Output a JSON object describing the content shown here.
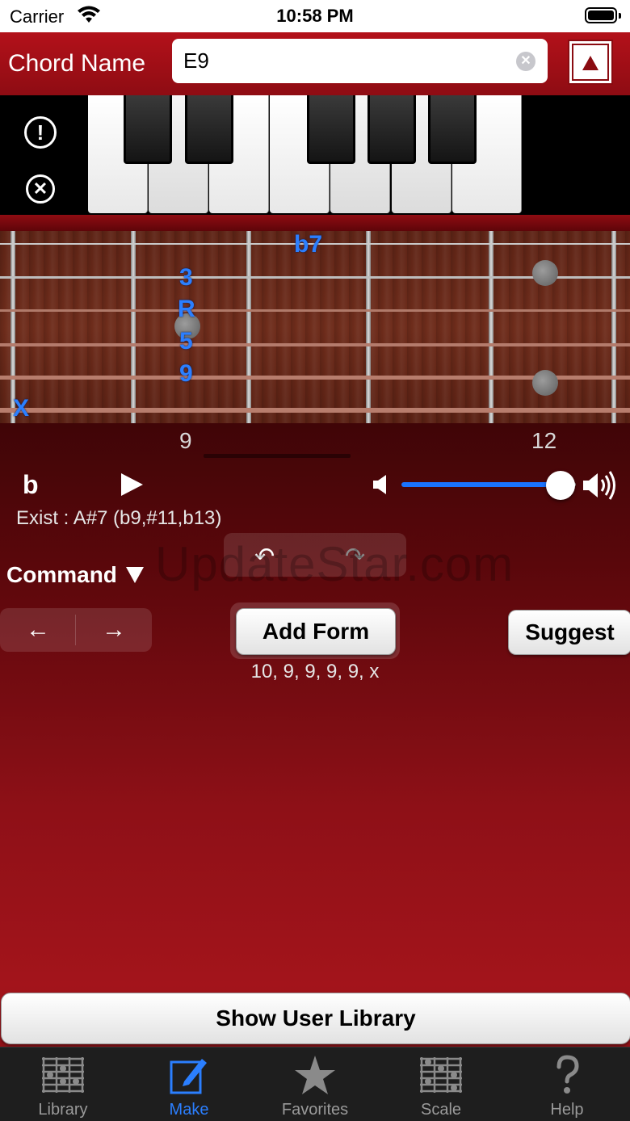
{
  "status_bar": {
    "carrier": "Carrier",
    "time": "10:58 PM"
  },
  "header": {
    "title": "Chord Name",
    "chord_value": "E9"
  },
  "fretboard": {
    "notes": [
      {
        "label": "b7",
        "fret": 10,
        "string": 1
      },
      {
        "label": "3",
        "fret": 9,
        "string": 2
      },
      {
        "label": "R",
        "fret": 9,
        "string": 3
      },
      {
        "label": "5",
        "fret": 9,
        "string": 4
      },
      {
        "label": "9",
        "fret": 9,
        "string": 5
      },
      {
        "label": "X",
        "fret": 0,
        "string": 6
      }
    ],
    "fret_labels": [
      "9",
      "12"
    ]
  },
  "controls": {
    "flat_label": "b",
    "exist_text": "Exist : A#7 (b9,#11,b13)",
    "volume": 0.9,
    "command_label": "Command",
    "add_form_label": "Add Form",
    "suggest_label": "Suggest",
    "fingering": "10, 9, 9, 9, 9, x",
    "watermark": "UpdateStar.com"
  },
  "user_library_button": "Show User Library",
  "tabs": [
    {
      "label": "Library",
      "icon": "library-icon",
      "active": false
    },
    {
      "label": "Make",
      "icon": "pencil-icon",
      "active": true
    },
    {
      "label": "Favorites",
      "icon": "star-icon",
      "active": false
    },
    {
      "label": "Scale",
      "icon": "scale-icon",
      "active": false
    },
    {
      "label": "Help",
      "icon": "help-icon",
      "active": false
    }
  ],
  "colors": {
    "accent": "#2b7fff",
    "header_red": "#b3111a",
    "note_blue": "#2b7fff"
  }
}
